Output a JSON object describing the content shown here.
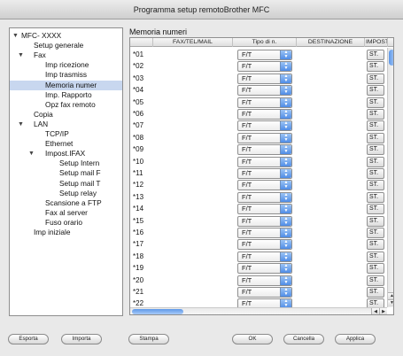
{
  "window": {
    "title": "Programma setup remotoBrother MFC"
  },
  "sidebar": {
    "items": [
      {
        "label": "MFC- XXXX",
        "level": 0,
        "toggle": "▼"
      },
      {
        "label": "Setup generale",
        "level": 1
      },
      {
        "label": "Fax",
        "level": 1,
        "toggle": "▼"
      },
      {
        "label": "Imp ricezione",
        "level": 2
      },
      {
        "label": "Imp trasmiss",
        "level": 2
      },
      {
        "label": "Memoria numer",
        "level": 2,
        "selected": true
      },
      {
        "label": "Imp. Rapporto",
        "level": 2
      },
      {
        "label": "Opz fax remoto",
        "level": 2
      },
      {
        "label": "Copia",
        "level": 1
      },
      {
        "label": "LAN",
        "level": 1,
        "toggle": "▼"
      },
      {
        "label": "TCP/IP",
        "level": 2
      },
      {
        "label": "Ethernet",
        "level": 2
      },
      {
        "label": "Impost.IFAX",
        "level": 2,
        "toggle": "▼"
      },
      {
        "label": "Setup Intern",
        "level": 3
      },
      {
        "label": "Setup mail F",
        "level": 3
      },
      {
        "label": "Setup mail T",
        "level": 3
      },
      {
        "label": "Setup relay",
        "level": 3
      },
      {
        "label": "Scansione a FTP",
        "level": 2
      },
      {
        "label": "Fax al server",
        "level": 2
      },
      {
        "label": "Fuso orario",
        "level": 2
      },
      {
        "label": "Imp iniziale",
        "level": 1
      }
    ]
  },
  "main": {
    "title": "Memoria numeri",
    "columns": [
      "",
      "FAX/TEL/MAIL",
      "Tipo di n.",
      "DESTINAZIONE",
      "IMPOSTA"
    ],
    "rows": [
      {
        "num": "*01",
        "type": "F/T",
        "set": "ST."
      },
      {
        "num": "*02",
        "type": "F/T",
        "set": "ST."
      },
      {
        "num": "*03",
        "type": "F/T",
        "set": "ST."
      },
      {
        "num": "*04",
        "type": "F/T",
        "set": "ST."
      },
      {
        "num": "*05",
        "type": "F/T",
        "set": "ST."
      },
      {
        "num": "*06",
        "type": "F/T",
        "set": "ST."
      },
      {
        "num": "*07",
        "type": "F/T",
        "set": "ST."
      },
      {
        "num": "*08",
        "type": "F/T",
        "set": "ST."
      },
      {
        "num": "*09",
        "type": "F/T",
        "set": "ST."
      },
      {
        "num": "*10",
        "type": "F/T",
        "set": "ST."
      },
      {
        "num": "*11",
        "type": "F/T",
        "set": "ST."
      },
      {
        "num": "*12",
        "type": "F/T",
        "set": "ST."
      },
      {
        "num": "*13",
        "type": "F/T",
        "set": "ST."
      },
      {
        "num": "*14",
        "type": "F/T",
        "set": "ST."
      },
      {
        "num": "*15",
        "type": "F/T",
        "set": "ST."
      },
      {
        "num": "*16",
        "type": "F/T",
        "set": "ST."
      },
      {
        "num": "*17",
        "type": "F/T",
        "set": "ST."
      },
      {
        "num": "*18",
        "type": "F/T",
        "set": "ST."
      },
      {
        "num": "*19",
        "type": "F/T",
        "set": "ST."
      },
      {
        "num": "*20",
        "type": "F/T",
        "set": "ST."
      },
      {
        "num": "*21",
        "type": "F/T",
        "set": "ST."
      },
      {
        "num": "*22",
        "type": "F/T",
        "set": "ST."
      }
    ]
  },
  "buttons": {
    "export": "Esporta",
    "import": "Importa",
    "print": "Stampa",
    "ok": "OK",
    "cancel": "Cancella",
    "apply": "Applica"
  },
  "colors": {
    "selection": "#c8d7ef",
    "accent": "#4e8ce6"
  }
}
